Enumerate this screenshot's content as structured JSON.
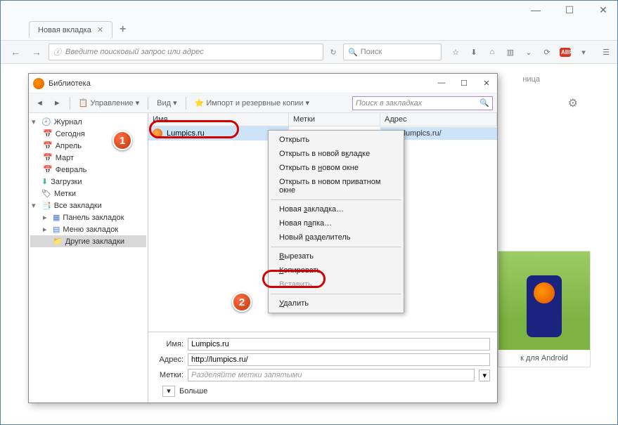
{
  "browser": {
    "tab_title": "Новая вкладка",
    "url_placeholder": "Введите поисковый запрос или адрес",
    "search_placeholder": "Поиск",
    "page_text_right": "ница",
    "card_label": "к для Android",
    "abp": "ABP"
  },
  "library": {
    "title": "Библиотека",
    "toolbar": {
      "manage": "Управление",
      "view": "Вид",
      "import": "Импорт и резервные копии"
    },
    "search_placeholder": "Поиск в закладках",
    "tree": {
      "journal": "Журнал",
      "today": "Сегодня",
      "april": "Апрель",
      "march": "Март",
      "february": "Февраль",
      "downloads": "Загрузки",
      "tags": "Метки",
      "all_bookmarks": "Все закладки",
      "toolbar_bm": "Панель закладок",
      "menu_bm": "Меню закладок",
      "other_bm": "Другие закладки"
    },
    "columns": {
      "name": "Имя",
      "tags": "Метки",
      "address": "Адрес"
    },
    "row": {
      "name": "Lumpics.ru",
      "address": "http://lumpics.ru/"
    },
    "details": {
      "name_label": "Имя:",
      "name_value": "Lumpics.ru",
      "addr_label": "Адрес:",
      "addr_value": "http://lumpics.ru/",
      "tags_label": "Метки:",
      "tags_placeholder": "Разделяйте метки запятыми",
      "more": "Больше"
    }
  },
  "ctx": {
    "open": "Открыть",
    "open_tab_pre": "Открыть в новой в",
    "open_tab_u": "к",
    "open_tab_post": "ладке",
    "open_win_pre": "Открыть в ",
    "open_win_u": "н",
    "open_win_post": "овом окне",
    "open_priv": "Открыть в новом приватном окне",
    "new_bm_pre": "Новая ",
    "new_bm_u": "з",
    "new_bm_post": "акладка…",
    "new_folder_pre": "Новая п",
    "new_folder_u": "а",
    "new_folder_post": "пка…",
    "new_sep_pre": "Новый ",
    "new_sep_u": "р",
    "new_sep_post": "азделитель",
    "cut_u": "В",
    "cut_post": "ырезать",
    "copy_u": "К",
    "copy_post": "опировать",
    "paste": "Вставить",
    "delete_u": "У",
    "delete_post": "далить"
  },
  "badges": {
    "one": "1",
    "two": "2"
  }
}
